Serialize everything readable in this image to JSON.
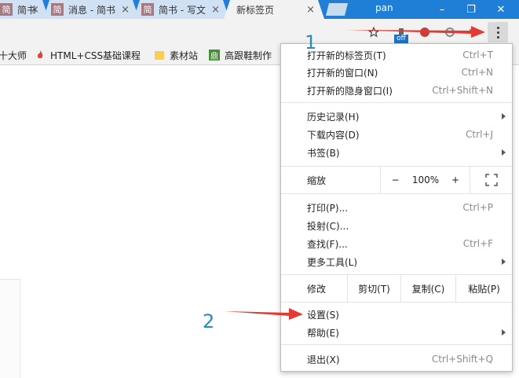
{
  "tabs": [
    {
      "label": "简书",
      "favicon": "简"
    },
    {
      "label": "消息 - 简书",
      "favicon": "简"
    },
    {
      "label": "简书 - 写文",
      "favicon": "简"
    },
    {
      "label": "新标签页",
      "favicon": ""
    }
  ],
  "tab_close": "×",
  "profile_name": "pan",
  "window_controls": [
    "–",
    "❐",
    "✕"
  ],
  "toolbar": {
    "star_icon": "star-icon",
    "extension_badge": "off",
    "menu_icon": "three-dots-vertical-icon"
  },
  "bookmarks": [
    {
      "label": "十大师"
    },
    {
      "label": "HTML+CSS基础课程"
    },
    {
      "label": "素材站"
    },
    {
      "label": "高跟鞋制作",
      "badge": "鼎"
    }
  ],
  "menu": {
    "new_tab": {
      "label": "打开新的标签页(T)",
      "shortcut": "Ctrl+T"
    },
    "new_window": {
      "label": "打开新的窗口(N)",
      "shortcut": "Ctrl+N"
    },
    "incognito": {
      "label": "打开新的隐身窗口(I)",
      "shortcut": "Ctrl+Shift+N"
    },
    "history": {
      "label": "历史记录(H)"
    },
    "downloads": {
      "label": "下载内容(D)",
      "shortcut": "Ctrl+J"
    },
    "bookmarks": {
      "label": "书签(B)"
    },
    "zoom": {
      "label": "缩放",
      "minus": "−",
      "value": "100%",
      "plus": "+"
    },
    "print": {
      "label": "打印(P)...",
      "shortcut": "Ctrl+P"
    },
    "cast": {
      "label": "投射(C)..."
    },
    "find": {
      "label": "查找(F)...",
      "shortcut": "Ctrl+F"
    },
    "more_tools": {
      "label": "更多工具(L)"
    },
    "edit": {
      "label": "修改",
      "cut": "剪切(T)",
      "copy": "复制(C)",
      "paste": "粘贴(P)"
    },
    "settings": {
      "label": "设置(S)"
    },
    "help": {
      "label": "帮助(E)"
    },
    "exit": {
      "label": "退出(X)",
      "shortcut": "Ctrl+Shift+Q"
    }
  },
  "annotations": {
    "step1": "1",
    "step2": "2",
    "arrow_color": "#e53935"
  },
  "colors": {
    "titlebar": "#1f7fd6",
    "menu_highlight": "#d9d9d9"
  }
}
